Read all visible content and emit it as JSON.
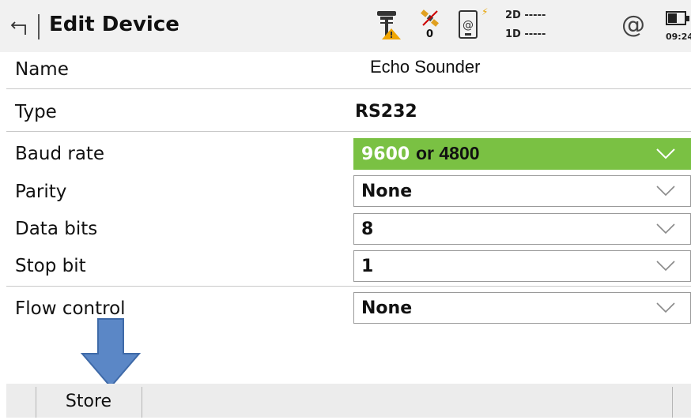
{
  "header": {
    "title": "Edit Device",
    "satellite_count": "0",
    "position_2d": "2D -----",
    "position_1d": "1D -----",
    "clock": "09:24"
  },
  "form": {
    "name": {
      "label": "Name",
      "value": "Echo Sounder"
    },
    "type": {
      "label": "Type",
      "value": "RS232"
    },
    "baud_rate": {
      "label": "Baud rate",
      "value": "9600",
      "annotation": "or 4800",
      "highlight_color": "#7ac143"
    },
    "parity": {
      "label": "Parity",
      "value": "None"
    },
    "data_bits": {
      "label": "Data bits",
      "value": "8"
    },
    "stop_bit": {
      "label": "Stop bit",
      "value": "1"
    },
    "flow_control": {
      "label": "Flow control",
      "value": "None"
    }
  },
  "footer": {
    "store_label": "Store"
  },
  "icons": {
    "back": "back-arrow-icon",
    "rover": "rover-warning-icon",
    "satellite": "satellite-icon",
    "device": "device-connection-icon",
    "connection": "at-connection-icon",
    "battery": "battery-icon",
    "dropdown": "chevron-down-icon",
    "annotation_arrow": "down-arrow-annotation"
  },
  "colors": {
    "accent_green": "#7ac143",
    "annotation_arrow": "#5b87c6",
    "topbar_bg": "#f1f1f1"
  }
}
